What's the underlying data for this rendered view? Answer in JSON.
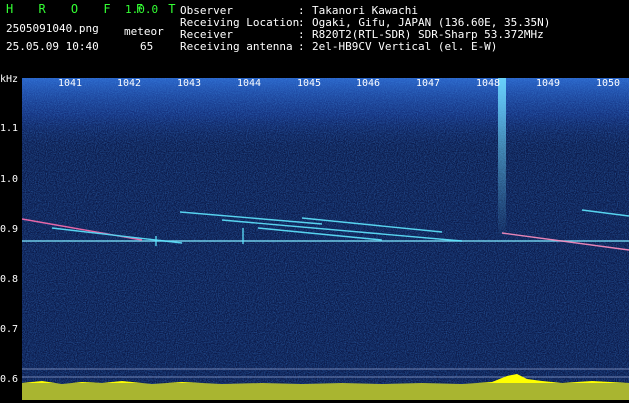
{
  "app": {
    "title": "H R O F F T",
    "version": "1.0.0",
    "filename": "2505091040.png",
    "datetime": "25.05.09 10:40",
    "mode_label": "meteor",
    "count": "65"
  },
  "header": {
    "rows": [
      {
        "label": "Observer",
        "value": "Takanori Kawachi"
      },
      {
        "label": "Receiving Location",
        "value": "Ogaki, Gifu, JAPAN (136.60E, 35.35N)"
      },
      {
        "label": "Receiver",
        "value": "R820T2(RTL-SDR) SDR-Sharp 53.372MHz"
      },
      {
        "label": "Receiving antenna",
        "value": "2el-HB9CV Vertical (el. E-W)"
      }
    ],
    "separator": ":"
  },
  "axis": {
    "unit": "kHz",
    "freq_labels": [
      "1.1",
      "1.0",
      "0.9",
      "0.8",
      "0.7",
      "0.6"
    ],
    "time_labels": [
      "1041",
      "1042",
      "1043",
      "1044",
      "1045",
      "1046",
      "1047",
      "1048",
      "1049",
      "1050"
    ]
  },
  "colors": {
    "header_green": "#33ff33",
    "background": "#000000",
    "spectrogram_bg": "#0b1a4a",
    "signal": "#5fe6ff",
    "meter": "#ffff00"
  }
}
